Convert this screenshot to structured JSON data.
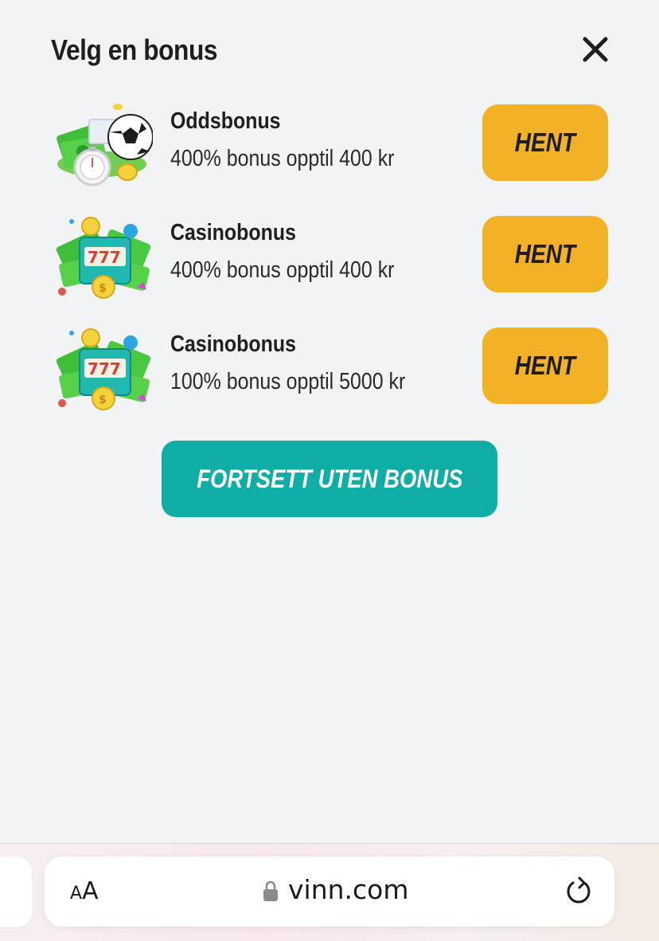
{
  "modal": {
    "title": "Velg en bonus",
    "close_icon": "close-icon"
  },
  "offers": [
    {
      "name": "Oddsbonus",
      "description": "400% bonus opptil 400 kr",
      "button": "HENT",
      "icon": "sports-bonus-icon"
    },
    {
      "name": "Casinobonus",
      "description": "400% bonus opptil 400 kr",
      "button": "HENT",
      "icon": "casino-bonus-icon"
    },
    {
      "name": "Casinobonus",
      "description": "100% bonus opptil 5000 kr",
      "button": "HENT",
      "icon": "casino-bonus-icon"
    }
  ],
  "continue_button": "FORTSETT UTEN BONUS",
  "browser": {
    "text_size_label_small": "A",
    "text_size_label_large": "A",
    "url": "vinn.com",
    "lock_icon": "lock-icon",
    "reload_icon": "reload-icon"
  },
  "colors": {
    "background": "#f1f3f5",
    "claim_button": "#f3b127",
    "continue_button": "#0eada6"
  }
}
